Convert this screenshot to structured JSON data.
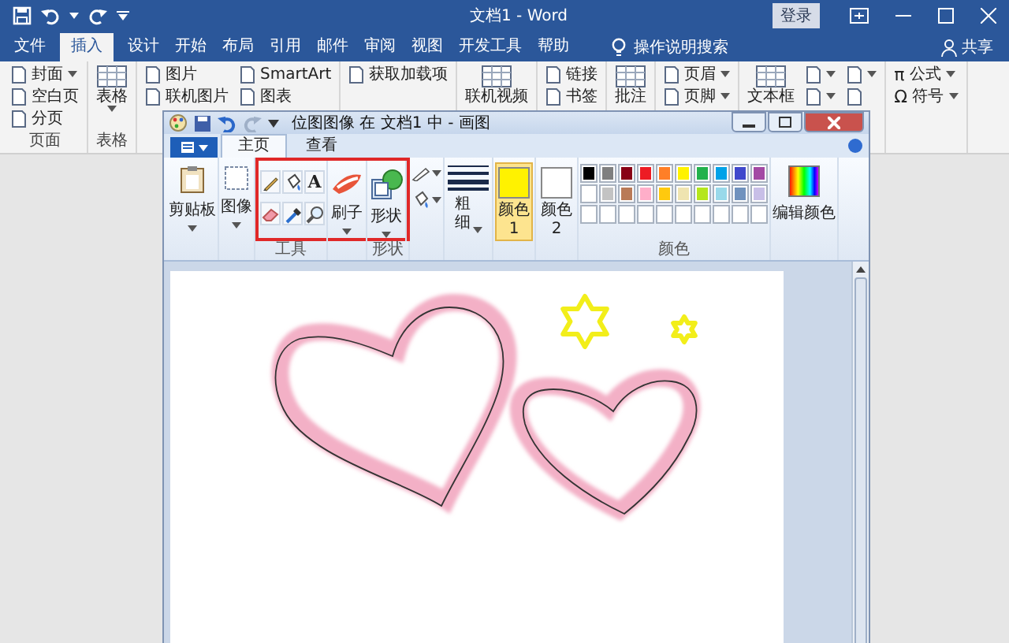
{
  "word": {
    "title": "文档1 - Word",
    "sign_in": "登录",
    "tabs": [
      {
        "label": "文件",
        "selected": false
      },
      {
        "label": "插入",
        "selected": true
      },
      {
        "label": "设计",
        "selected": false
      },
      {
        "label": "开始",
        "selected": false
      },
      {
        "label": "布局",
        "selected": false
      },
      {
        "label": "引用",
        "selected": false
      },
      {
        "label": "邮件",
        "selected": false
      },
      {
        "label": "审阅",
        "selected": false
      },
      {
        "label": "视图",
        "selected": false
      },
      {
        "label": "开发工具",
        "selected": false
      },
      {
        "label": "帮助",
        "selected": false
      }
    ],
    "tell_me": "操作说明搜索",
    "share": "共享",
    "ribbon": [
      {
        "label": "页面",
        "columns": [
          [
            {
              "kind": "small",
              "label": "封面",
              "dropdown": true
            },
            {
              "kind": "small",
              "label": "空白页",
              "dropdown": false
            },
            {
              "kind": "small",
              "label": "分页",
              "dropdown": false
            }
          ]
        ]
      },
      {
        "label": "表格",
        "columns": [
          [
            {
              "kind": "large",
              "label": "表格",
              "dropdown": true
            }
          ]
        ]
      },
      {
        "columns": [
          [
            {
              "kind": "small",
              "label": "图片",
              "dropdown": false
            },
            {
              "kind": "small",
              "label": "联机图片",
              "dropdown": false
            }
          ],
          [
            {
              "kind": "small",
              "label": "SmartArt",
              "dropdown": false
            },
            {
              "kind": "small",
              "label": "图表",
              "dropdown": false
            }
          ]
        ]
      },
      {
        "columns": [
          [
            {
              "kind": "small",
              "label": "获取加载项",
              "dropdown": false
            }
          ]
        ]
      },
      {
        "columns": [
          [
            {
              "kind": "large",
              "label": "联机视频",
              "dropdown": false
            }
          ]
        ]
      },
      {
        "columns": [
          [
            {
              "kind": "small",
              "label": "链接",
              "dropdown": false
            },
            {
              "kind": "small",
              "label": "书签",
              "dropdown": false
            }
          ]
        ]
      },
      {
        "columns": [
          [
            {
              "kind": "large",
              "label": "批注",
              "dropdown": false
            }
          ]
        ]
      },
      {
        "columns": [
          [
            {
              "kind": "small",
              "label": "页眉",
              "dropdown": true
            },
            {
              "kind": "small",
              "label": "页脚",
              "dropdown": true
            }
          ]
        ]
      },
      {
        "columns": [
          [
            {
              "kind": "large",
              "label": "文本框",
              "dropdown": false
            }
          ],
          [
            {
              "kind": "icon",
              "dropdown": true
            },
            {
              "kind": "icon",
              "dropdown": true
            }
          ],
          [
            {
              "kind": "icon",
              "dropdown": true
            },
            {
              "kind": "icon",
              "dropdown": false
            }
          ]
        ]
      },
      {
        "columns": [
          [
            {
              "kind": "symbol",
              "glyph": "π",
              "label": "公式",
              "dropdown": true
            },
            {
              "kind": "symbol",
              "glyph": "Ω",
              "label": "符号",
              "dropdown": true
            }
          ]
        ]
      }
    ]
  },
  "paint": {
    "title": "位图图像 在 文档1 中 - 画图",
    "tabs": [
      {
        "label": "主页",
        "selected": true
      },
      {
        "label": "查看",
        "selected": false
      }
    ],
    "sections": [
      {
        "kind": "large",
        "label": "剪贴板",
        "highlighted": false
      },
      {
        "kind": "large",
        "label": "图像",
        "highlighted": false
      },
      {
        "kind": "tools",
        "group_label": "工具",
        "highlighted": true,
        "tools": [
          {
            "kind": "pencil"
          },
          {
            "kind": "fill"
          },
          {
            "kind": "text",
            "glyph": "A"
          },
          {
            "kind": "eraser"
          },
          {
            "kind": "picker"
          },
          {
            "kind": "magnifier"
          }
        ]
      },
      {
        "kind": "large",
        "label": "刷子",
        "highlighted": true
      },
      {
        "kind": "large",
        "label": "形状",
        "group_label": "形状",
        "highlighted": true
      },
      {
        "kind": "shape_options",
        "highlighted": false
      },
      {
        "kind": "size",
        "label": "粗细",
        "highlighted": false
      },
      {
        "kind": "color_slot",
        "label": "颜色 1",
        "color": "#fff200",
        "selected": true,
        "highlighted": false
      },
      {
        "kind": "color_slot",
        "label": "颜色 2",
        "color": "#ffffff",
        "selected": false,
        "highlighted": false
      },
      {
        "kind": "palette",
        "group_label": "颜色",
        "highlighted": false,
        "colors": [
          {
            "color": "#000000"
          },
          {
            "color": "#7f7f7f"
          },
          {
            "color": "#880015"
          },
          {
            "color": "#ed1c24"
          },
          {
            "color": "#ff7f27"
          },
          {
            "color": "#fff200"
          },
          {
            "color": "#22b14c"
          },
          {
            "color": "#00a2e8"
          },
          {
            "color": "#3f48cc"
          },
          {
            "color": "#a349a4"
          },
          {
            "color": "#ffffff"
          },
          {
            "color": "#c3c3c3"
          },
          {
            "color": "#b97a57"
          },
          {
            "color": "#ffaec9"
          },
          {
            "color": "#ffc90e"
          },
          {
            "color": "#efe4b0"
          },
          {
            "color": "#b5e61d"
          },
          {
            "color": "#99d9ea"
          },
          {
            "color": "#7092be"
          },
          {
            "color": "#c8bfe7"
          },
          {
            "color": "#ffffff"
          },
          {
            "color": "#ffffff"
          },
          {
            "color": "#ffffff"
          },
          {
            "color": "#ffffff"
          },
          {
            "color": "#ffffff"
          },
          {
            "color": "#ffffff"
          },
          {
            "color": "#ffffff"
          },
          {
            "color": "#ffffff"
          },
          {
            "color": "#ffffff"
          },
          {
            "color": "#ffffff"
          }
        ]
      },
      {
        "kind": "edit_colors",
        "label": "编辑颜色",
        "highlighted": false
      }
    ]
  }
}
